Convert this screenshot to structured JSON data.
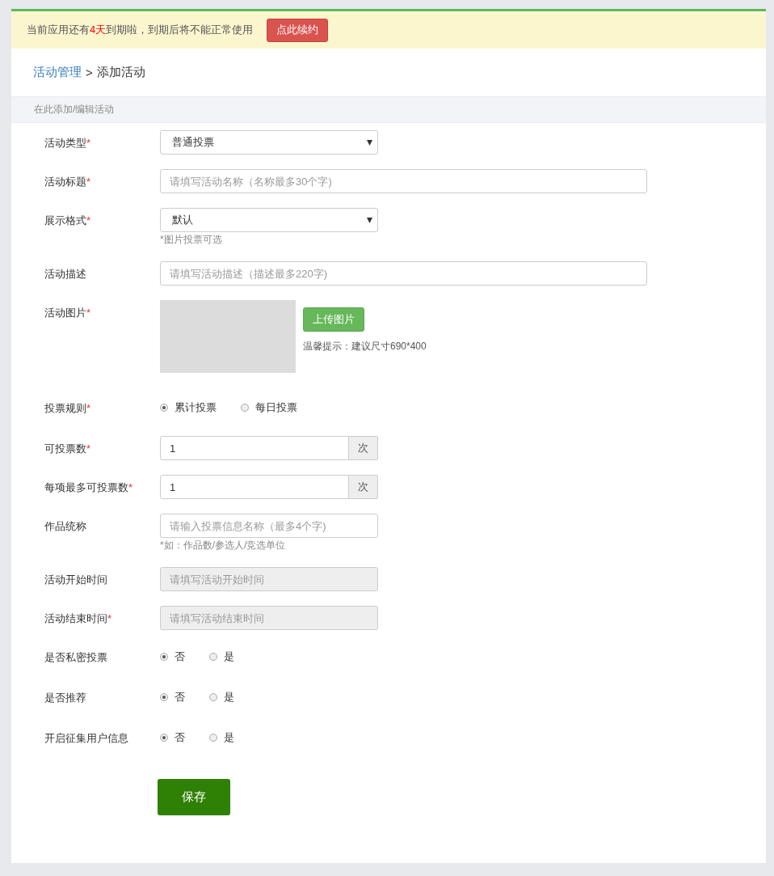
{
  "banner": {
    "segments": [
      {
        "kind": "normal",
        "text": "当前应用还有"
      },
      {
        "kind": "highlight",
        "text": "4天"
      },
      {
        "kind": "normal",
        "text": "到期啦，到期后将不能正常使用"
      }
    ],
    "button": "点此续约"
  },
  "breadcrumb": {
    "parent": "活动管理",
    "separator": ">",
    "current": "添加活动"
  },
  "section_title": "在此添加/编辑活动",
  "fields": [
    {
      "kind": "select",
      "label": "活动类型",
      "required_mark": "*",
      "value": "普通投票"
    },
    {
      "kind": "text",
      "label": "活动标题",
      "required_mark": "*",
      "placeholder": "请填写活动名称（名称最多30个字)",
      "disabled": false
    },
    {
      "kind": "select",
      "label": "展示格式",
      "required_mark": "*",
      "value": "默认",
      "hint": "*图片投票可选"
    },
    {
      "kind": "text",
      "label": "活动描述",
      "placeholder": "请填写活动描述（描述最多220字)",
      "disabled": false
    },
    {
      "kind": "image",
      "label": "活动图片",
      "required_mark": "*",
      "button": "上传图片",
      "tip": "温馨提示：建议尺寸690*400"
    },
    {
      "kind": "radio",
      "label": "投票规则",
      "required_mark": "*",
      "options": [
        {
          "label": "累计投票",
          "selected": true
        },
        {
          "label": "每日投票",
          "selected": false
        }
      ]
    },
    {
      "kind": "addon",
      "label": "可投票数",
      "required_mark": "*",
      "value": "1",
      "unit": "次"
    },
    {
      "kind": "addon",
      "label": "每项最多可投票数",
      "required_mark": "*",
      "value": "1",
      "unit": "次"
    },
    {
      "kind": "short",
      "label": "作品统称",
      "placeholder": "请输入投票信息名称（最多4个字)",
      "disabled": false,
      "hint": "*如：作品数/参选人/竞选单位"
    },
    {
      "kind": "short",
      "label": "活动开始时间",
      "placeholder": "请填写活动开始时间",
      "disabled": true
    },
    {
      "kind": "short",
      "label": "活动结束时间",
      "required_mark": "*",
      "placeholder": "请填写活动结束时间",
      "disabled": true
    },
    {
      "kind": "radio",
      "label": "是否私密投票",
      "options": [
        {
          "label": "否",
          "selected": true
        },
        {
          "label": "是",
          "selected": false
        }
      ]
    },
    {
      "kind": "radio",
      "label": "是否推荐",
      "options": [
        {
          "label": "否",
          "selected": true
        },
        {
          "label": "是",
          "selected": false
        }
      ]
    },
    {
      "kind": "radio",
      "label": "开启征集用户信息",
      "options": [
        {
          "label": "否",
          "selected": true
        },
        {
          "label": "是",
          "selected": false
        }
      ]
    }
  ],
  "save_button": "保存"
}
